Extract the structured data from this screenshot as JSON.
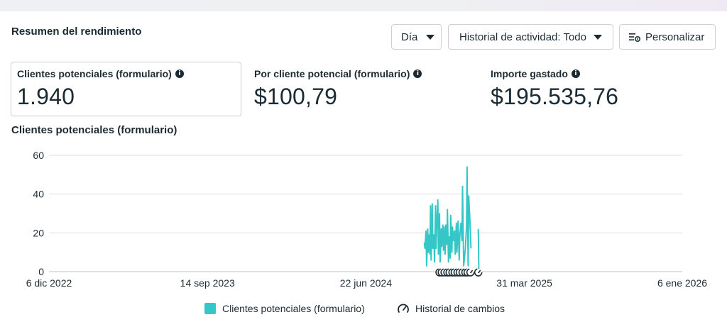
{
  "panel": {
    "title": "Resumen del rendimiento"
  },
  "controls": {
    "day_label": "Día",
    "history_label": "Historial de actividad: Todo",
    "customize_label": "Personalizar"
  },
  "metrics": [
    {
      "label": "Clientes potenciales (formulario)",
      "value": "1.940"
    },
    {
      "label": "Por cliente potencial (formulario)",
      "value": "$100,79"
    },
    {
      "label": "Importe gastado",
      "value": "$195.535,76"
    }
  ],
  "icons": {
    "info": "info-icon",
    "customize": "settings-sliders-icon",
    "history": "gauge-history-icon",
    "dropdown": "caret-down-icon"
  },
  "colors": {
    "series": "#35c7c7",
    "text": "#1c2b33",
    "border": "#ccd0d5",
    "grid": "#dadde1"
  },
  "chart_title": "Clientes potenciales (formulario)",
  "chart_data": {
    "type": "line",
    "title": "Clientes potenciales (formulario)",
    "xlabel": "",
    "ylabel": "",
    "ylim": [
      0,
      60
    ],
    "yticks": [
      0,
      20,
      40,
      60
    ],
    "xlim": [
      "2022-12-06",
      "2026-01-06"
    ],
    "xticks": [
      "2022-12-06",
      "2023-09-14",
      "2024-06-22",
      "2025-03-31",
      "2026-01-06"
    ],
    "xtick_labels": [
      "6 dic 2022",
      "14 sep 2023",
      "22 jun 2024",
      "31 mar 2025",
      "6 ene 2026"
    ],
    "grid": true,
    "legend_position": "bottom",
    "series": [
      {
        "name": "Clientes potenciales (formulario)",
        "color": "#35c7c7",
        "points": [
          [
            "2024-10-04",
            15
          ],
          [
            "2024-10-05",
            12
          ],
          [
            "2024-10-07",
            21
          ],
          [
            "2024-10-08",
            3
          ],
          [
            "2024-10-10",
            22
          ],
          [
            "2024-10-11",
            10
          ],
          [
            "2024-10-13",
            19
          ],
          [
            "2024-10-14",
            9
          ],
          [
            "2024-10-15",
            34
          ],
          [
            "2024-10-16",
            6
          ],
          [
            "2024-10-18",
            35
          ],
          [
            "2024-10-19",
            12
          ],
          [
            "2024-10-21",
            19
          ],
          [
            "2024-10-22",
            5
          ],
          [
            "2024-10-24",
            34
          ],
          [
            "2024-10-25",
            12
          ],
          [
            "2024-10-26",
            24
          ],
          [
            "2024-10-28",
            37
          ],
          [
            "2024-10-29",
            9
          ],
          [
            "2024-10-31",
            30
          ],
          [
            "2024-11-01",
            5
          ],
          [
            "2024-11-03",
            22
          ],
          [
            "2024-11-04",
            13
          ],
          [
            "2024-11-06",
            24
          ],
          [
            "2024-11-07",
            11
          ],
          [
            "2024-11-08",
            23
          ],
          [
            "2024-11-10",
            9
          ],
          [
            "2024-11-11",
            24
          ],
          [
            "2024-11-13",
            14
          ],
          [
            "2024-11-14",
            32
          ],
          [
            "2024-11-16",
            5
          ],
          [
            "2024-11-17",
            18
          ],
          [
            "2024-11-19",
            7
          ],
          [
            "2024-11-20",
            29
          ],
          [
            "2024-11-22",
            10
          ],
          [
            "2024-11-23",
            23
          ],
          [
            "2024-11-25",
            16
          ],
          [
            "2024-11-27",
            21
          ],
          [
            "2024-11-28",
            9
          ],
          [
            "2024-11-30",
            25
          ],
          [
            "2024-12-01",
            10
          ],
          [
            "2024-12-03",
            26
          ],
          [
            "2024-12-05",
            6
          ],
          [
            "2024-12-06",
            18
          ],
          [
            "2024-12-08",
            25
          ],
          [
            "2024-12-10",
            16
          ],
          [
            "2024-12-11",
            44
          ],
          [
            "2024-12-13",
            3
          ],
          [
            "2024-12-16",
            12
          ],
          [
            "2024-12-18",
            23
          ],
          [
            "2024-12-19",
            54
          ],
          [
            "2024-12-21",
            3
          ],
          [
            "2024-12-22",
            39
          ],
          [
            "2024-12-24",
            27
          ],
          [
            "2024-12-26",
            12
          ]
        ]
      },
      {
        "name": "Clientes potenciales (formulario)",
        "color": "#35c7c7",
        "points": [
          [
            "2025-01-08",
            22
          ],
          [
            "2025-01-09",
            0
          ]
        ]
      }
    ],
    "change_markers": [
      "2024-10-31",
      "2024-11-04",
      "2024-11-09",
      "2024-11-14",
      "2024-11-18",
      "2024-11-23",
      "2024-11-27",
      "2024-12-02",
      "2024-12-06",
      "2024-12-11",
      "2024-12-16",
      "2024-12-20",
      "2024-12-25",
      "2025-01-08"
    ]
  },
  "legend": {
    "series_label": "Clientes potenciales (formulario)",
    "history_label": "Historial de cambios"
  }
}
